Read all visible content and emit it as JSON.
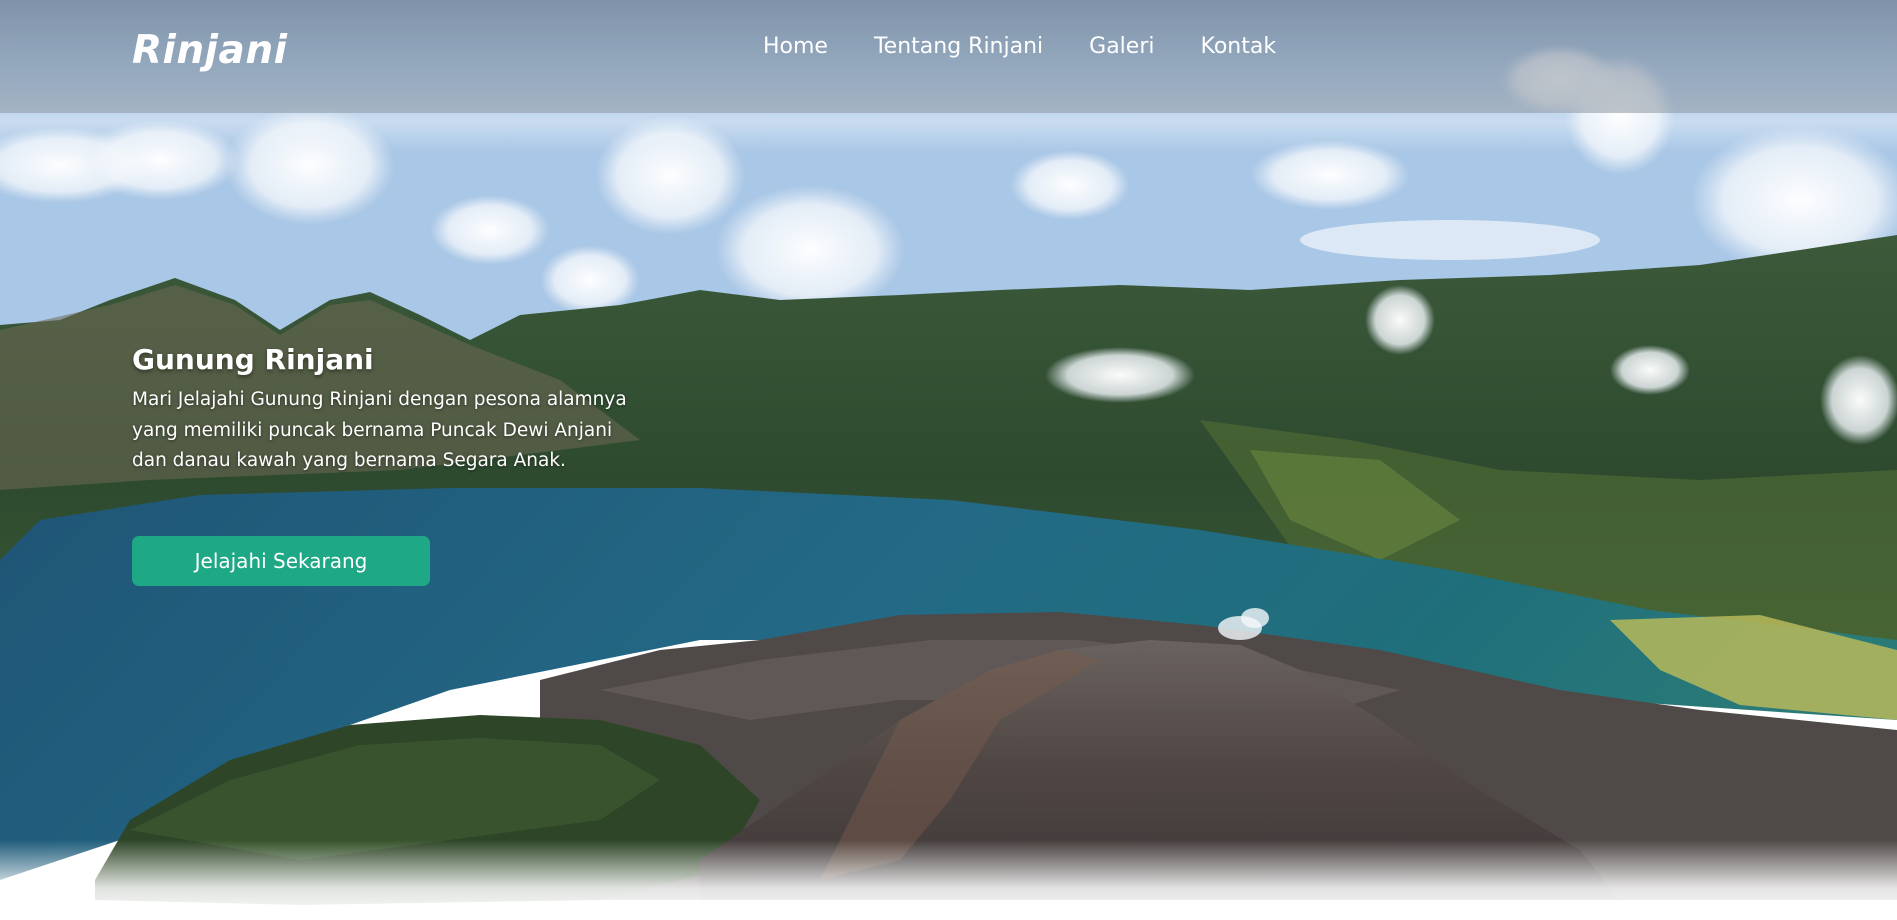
{
  "nav": {
    "brand": "Rinjani",
    "links": [
      "Home",
      "Tentang Rinjani",
      "Galeri",
      "Kontak"
    ]
  },
  "hero": {
    "title": "Gunung Rinjani",
    "description": "Mari Jelajahi Gunung Rinjani dengan pesona alamnya yang memiliki puncak bernama Puncak Dewi Anjani dan danau kawah yang bernama Segara Anak.",
    "cta_label": "Jelajahi Sekarang"
  },
  "colors": {
    "accent": "#1fa886",
    "navbar": "#8c96a0"
  }
}
